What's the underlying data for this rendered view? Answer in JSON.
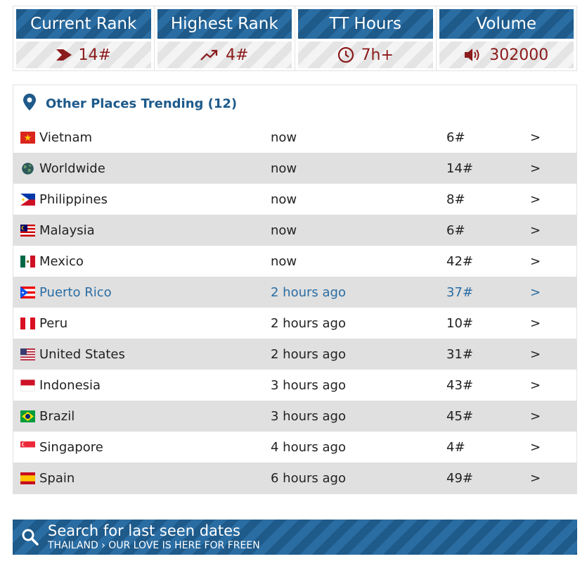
{
  "stats": [
    {
      "label": "Current Rank",
      "value": "14#",
      "icon": "chevron-right-icon"
    },
    {
      "label": "Highest Rank",
      "value": "4#",
      "icon": "trend-up-icon"
    },
    {
      "label": "TT Hours",
      "value": "7h+",
      "icon": "clock-icon"
    },
    {
      "label": "Volume",
      "value": "302000",
      "icon": "speaker-icon"
    }
  ],
  "places": {
    "title": "Other Places Trending (12)",
    "icon": "map-pin-icon",
    "rows": [
      {
        "name": "Vietnam",
        "time": "now",
        "rank": "6#",
        "arrow": ">"
      },
      {
        "name": "Worldwide",
        "time": "now",
        "rank": "14#",
        "arrow": ">"
      },
      {
        "name": "Philippines",
        "time": "now",
        "rank": "8#",
        "arrow": ">"
      },
      {
        "name": "Malaysia",
        "time": "now",
        "rank": "6#",
        "arrow": ">"
      },
      {
        "name": "Mexico",
        "time": "now",
        "rank": "42#",
        "arrow": ">"
      },
      {
        "name": "Puerto Rico",
        "time": "2 hours ago",
        "rank": "37#",
        "arrow": ">"
      },
      {
        "name": "Peru",
        "time": "2 hours ago",
        "rank": "10#",
        "arrow": ">"
      },
      {
        "name": "United States",
        "time": "2 hours ago",
        "rank": "31#",
        "arrow": ">"
      },
      {
        "name": "Indonesia",
        "time": "3 hours ago",
        "rank": "43#",
        "arrow": ">"
      },
      {
        "name": "Brazil",
        "time": "3 hours ago",
        "rank": "45#",
        "arrow": ">"
      },
      {
        "name": "Singapore",
        "time": "4 hours ago",
        "rank": "4#",
        "arrow": ">"
      },
      {
        "name": "Spain",
        "time": "6 hours ago",
        "rank": "49#",
        "arrow": ">"
      }
    ]
  },
  "search": {
    "title": "Search for last seen dates",
    "subtitle": "THAILAND › OUR LOVE IS HERE FOR FREEN",
    "icon": "search-icon"
  },
  "colors": {
    "header_blue": "#1e5a8a",
    "value_red": "#8b1a1a",
    "highlight_blue": "#2a6da3",
    "row_stripe": "#e0e0e0"
  }
}
